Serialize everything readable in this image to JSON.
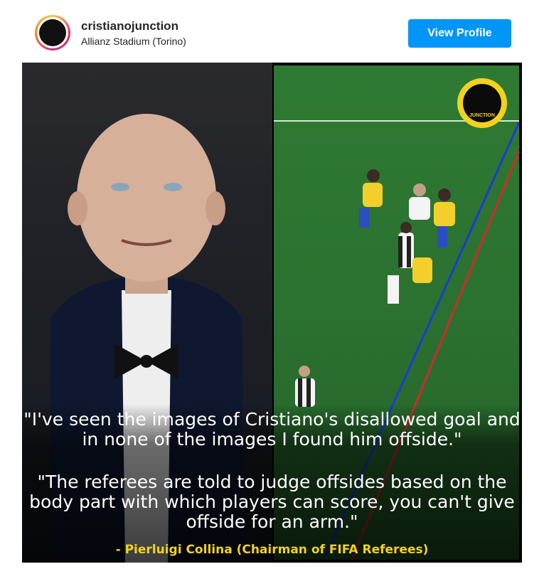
{
  "header": {
    "username": "cristianojunction",
    "location": "Allianz Stadium (Torino)",
    "view_profile_label": "View Profile"
  },
  "post": {
    "badge_text": "JUNCTION",
    "quote_1": "\"I've seen the images of Cristiano's disallowed goal and in none of the images I found him offside.\"",
    "quote_2": "\"The referees are told to judge offsides based on the body part with which players can score, you can't give offside for an arm.\"",
    "credit": "- Pierluigi Collina (Chairman of FIFA Referees)"
  },
  "colors": {
    "button": "#0095f6",
    "credit_yellow": "#f2d21f",
    "pitch_green": "#2b7130"
  }
}
